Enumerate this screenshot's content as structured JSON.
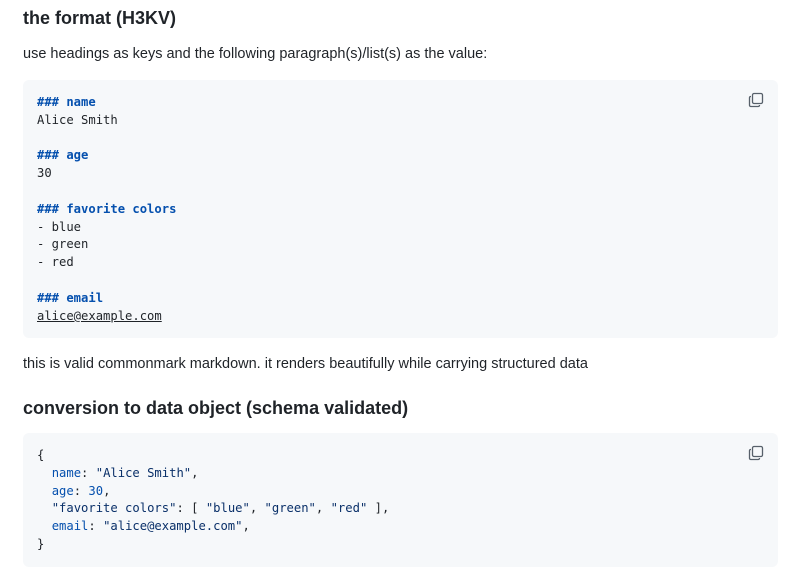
{
  "section1": {
    "heading": "the format (H3KV)",
    "intro": "use headings as keys and the following paragraph(s)/list(s) as the value:"
  },
  "code1": {
    "h_name": "### name",
    "v_name": "Alice Smith",
    "h_age": "### age",
    "v_age": "30",
    "h_colors": "### favorite colors",
    "v_color1": "- blue",
    "v_color2": "- green",
    "v_color3": "- red",
    "h_email": "### email",
    "v_email": "alice@example.com"
  },
  "note": "this is valid commonmark markdown. it renders beautifully while carrying structured data",
  "section2": {
    "heading": "conversion to data object (schema validated)"
  },
  "code2": {
    "open": "{",
    "name_key": "name",
    "name_val": "\"Alice Smith\"",
    "age_key": "age",
    "age_val": "30",
    "colors_key": "\"favorite colors\"",
    "colors_val_open": "[ ",
    "c1": "\"blue\"",
    "c2": "\"green\"",
    "c3": "\"red\"",
    "colors_val_close": " ]",
    "email_key": "email",
    "email_val": "\"alice@example.com\"",
    "close": "}"
  },
  "icons": {
    "copy": "copy-icon"
  }
}
